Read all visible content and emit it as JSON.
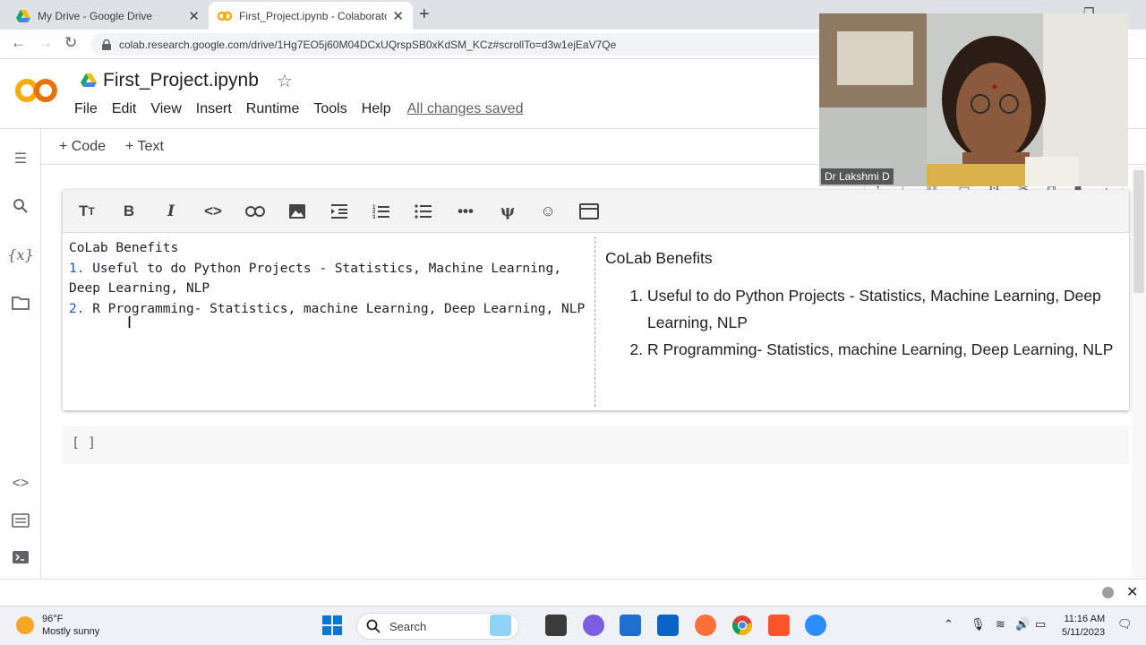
{
  "browser": {
    "tabs": [
      {
        "title": "My Drive - Google Drive",
        "close": "✕"
      },
      {
        "title": "First_Project.ipynb - Colaboratory",
        "close": "✕"
      }
    ],
    "new_tab": "+",
    "url": "colab.research.google.com/drive/1Hg7EO5j60M04DCxUQrspSB0xKdSM_KCz#scrollTo=d3w1ejEaV7Qe"
  },
  "colab": {
    "logo_text": "CO",
    "notebook_title": "First_Project.ipynb",
    "menu": [
      "File",
      "Edit",
      "View",
      "Insert",
      "Runtime",
      "Tools",
      "Help"
    ],
    "save_status": "All changes saved",
    "add_code": "+ Code",
    "add_text": "+ Text"
  },
  "cell": {
    "editor_lines": [
      {
        "num": "",
        "text": "CoLab Benefits"
      },
      {
        "num": "1.",
        "text": " Useful to do Python Projects - Statistics, Machine Learning, Deep Learning, NLP"
      },
      {
        "num": "2.",
        "text": " R Programming- Statistics, machine Learning, Deep Learning, NLP"
      }
    ],
    "preview_heading": "CoLab Benefits",
    "preview_items": [
      "Useful to do Python Projects - Statistics, Machine Learning, Deep Learning, NLP",
      "R Programming- Statistics, machine Learning, Deep Learning, NLP"
    ]
  },
  "code_cell": {
    "run_placeholder": "[ ]"
  },
  "video": {
    "participant_name": "Dr Lakshmi D"
  },
  "taskbar": {
    "temperature": "96°F",
    "weather": "Mostly sunny",
    "search": "Search",
    "time": "11:16 AM",
    "date": "5/11/2023"
  },
  "colors": {
    "accent": "#f9ab00",
    "link": "#1a56c9"
  }
}
